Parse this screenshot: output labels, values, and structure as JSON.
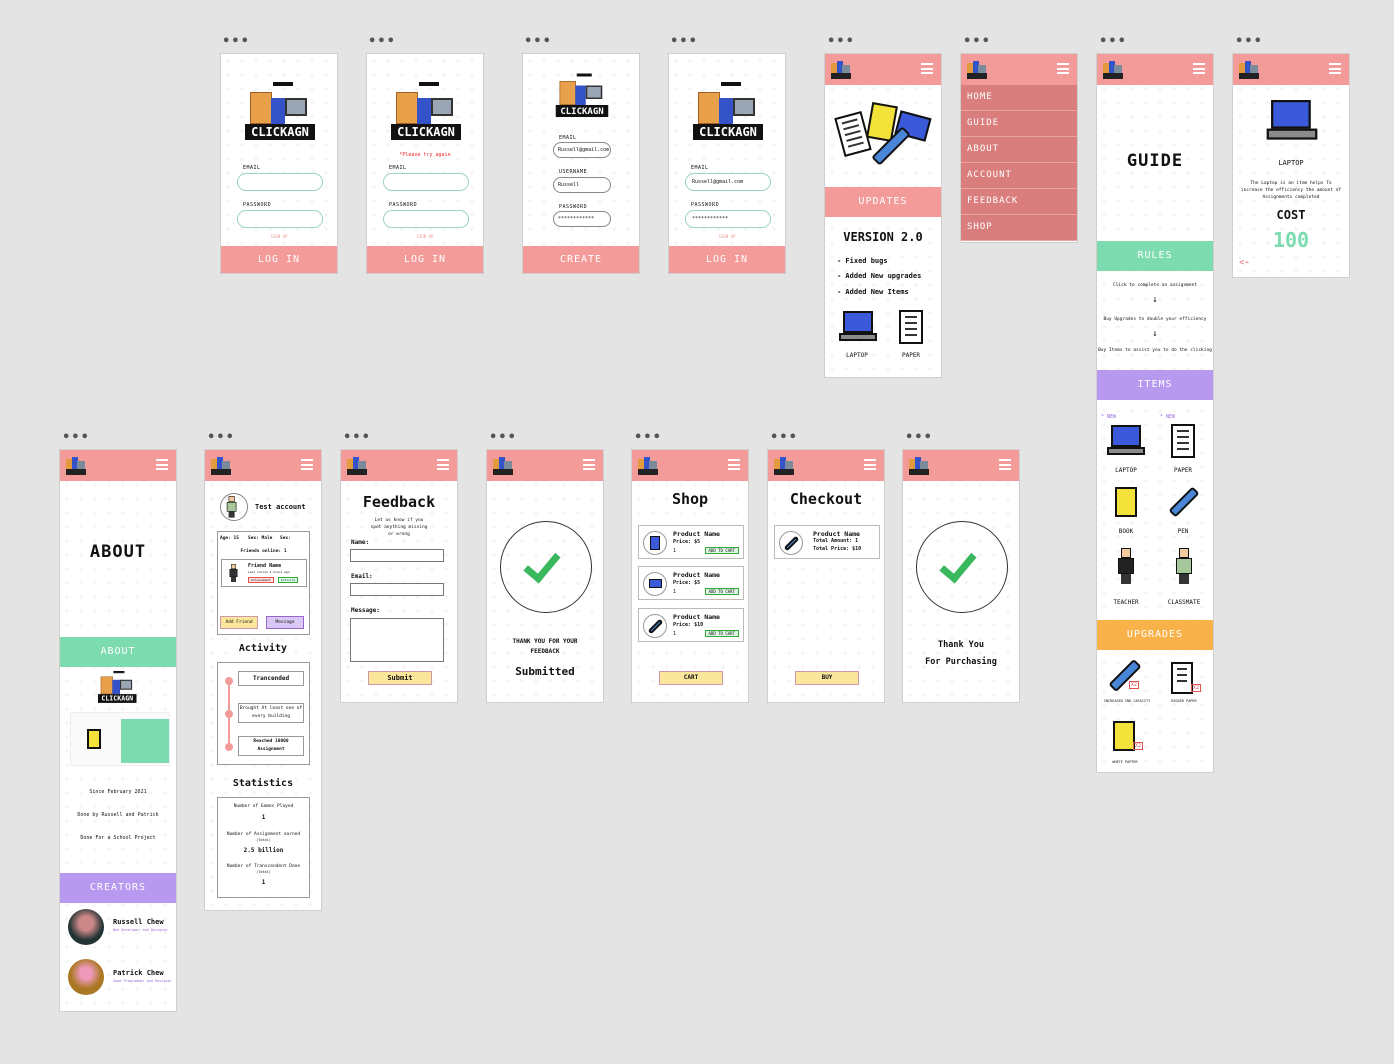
{
  "login_screens": [
    {
      "email_label": "EMAIL",
      "password_label": "PASSWORD",
      "signup": "SIGN UP",
      "button": "LOG IN"
    },
    {
      "error": "*Please try again",
      "email_label": "EMAIL",
      "password_label": "PASSWORD",
      "signup": "SIGN UP",
      "button": "LOG IN"
    },
    {
      "email_label": "EMAIL",
      "email_value": "Russell@gmail.com",
      "username_label": "USERNAME",
      "username_value": "Russell",
      "password_label": "PASSWORD",
      "password_value": "************",
      "button": "CREATE"
    },
    {
      "email_label": "EMAIL",
      "email_value": "Russell@gmail.com",
      "password_label": "PASSWORD",
      "password_value": "************",
      "signup": "SIGN UP",
      "button": "LOG IN"
    }
  ],
  "logo_word": "CLICKAGN",
  "home": {
    "updates": "UPDATES",
    "version": "VERSION 2.0",
    "notes": [
      "- Fixed bugs",
      "- Added New upgrades",
      "- Added New Items"
    ],
    "items": [
      "LAPTOP",
      "PAPER"
    ]
  },
  "menu": [
    "HOME",
    "GUIDE",
    "ABOUT",
    "ACCOUNT",
    "FEEDBACK",
    "SHOP"
  ],
  "guide": {
    "title": "GUIDE",
    "rules": "RULES",
    "rule_lines": [
      "Click to complete an assignment",
      "Buy Upgrades to double your efficiency",
      "Buy Items to assist you to do the clicking"
    ],
    "items_header": "ITEMS",
    "new_tag": "* NEW",
    "items": [
      "LAPTOP",
      "PAPER",
      "BOOK",
      "PEN",
      "TEACHER",
      "CLASSMATE"
    ],
    "upgrades_header": "UPGRADES",
    "upgrades": [
      "INCREASED INK CAPACITY",
      "BIGGER PAPER",
      "WHITE PAPTER"
    ],
    "x2": "X2"
  },
  "item_detail": {
    "name": "LAPTOP",
    "desc": "The Laptop is an item helps To increase the efficiency the amount of Assignments completed",
    "cost_label": "COST",
    "cost": "100",
    "back": "<-"
  },
  "about": {
    "title": "ABOUT",
    "band": "ABOUT",
    "since": "Since February 2021",
    "by": "Done by Russell and Patrick",
    "for": "Done For a School Project",
    "creators_band": "CREATORS",
    "creators": [
      {
        "name": "Russell Chew",
        "role": "Web Developer and Designer"
      },
      {
        "name": "Patrick Chew",
        "role": "Game Programmer and Designer"
      }
    ]
  },
  "account": {
    "name": "Test account",
    "age": "Age: 15",
    "sex": "Sex: Male",
    "sex2": "Sex:",
    "friends_online": "Friends online: 1",
    "friend_name": "Friend Name",
    "friend_status": "Last online 4 hours ago",
    "tag1": "Achievement",
    "tag2": "Activity",
    "add_friend": "Add Friend",
    "message": "Message",
    "activity_title": "Activity",
    "activity": [
      "Trancended",
      "Brought At least one of every building",
      "Reached 10000 Assignment"
    ],
    "stats_title": "Statistics",
    "stats": [
      {
        "label": "Number of Games Played",
        "value": "1"
      },
      {
        "label": "Number of Assignment earned",
        "sub": "(Total)",
        "value": "2.5 billion"
      },
      {
        "label": "Number of Transcendent Done",
        "sub": "(Total)",
        "value": "1"
      }
    ]
  },
  "feedback": {
    "title": "Feedback",
    "sub": "Let us know if you spot anything missing or wrong",
    "name": "Name:",
    "email": "Email:",
    "message": "Message:",
    "submit": "Submit"
  },
  "submitted": {
    "line1": "THANK YOU FOR YOUR FEEDBACK",
    "line2": "Submitted"
  },
  "shop": {
    "title": "Shop",
    "products": [
      {
        "name": "Product Name",
        "price": "Price: $5"
      },
      {
        "name": "Product Name",
        "price": "Price: $5"
      },
      {
        "name": "Product Name",
        "price": "Price: $10"
      }
    ],
    "qty": "1",
    "add": "ADD TO CART",
    "cart": "CART"
  },
  "checkout": {
    "title": "Checkout",
    "name": "Product Name",
    "amount": "Total Amount: 1",
    "price": "Total Price: $10",
    "buy": "BUY"
  },
  "purchased": {
    "line1": "Thank You",
    "line2": "For Purchasing"
  },
  "colors": {
    "pink": "#f29b99",
    "green": "#7ddbb0",
    "purple": "#b79af0",
    "orange": "#f9b24a",
    "menu": "#d97e7d"
  }
}
